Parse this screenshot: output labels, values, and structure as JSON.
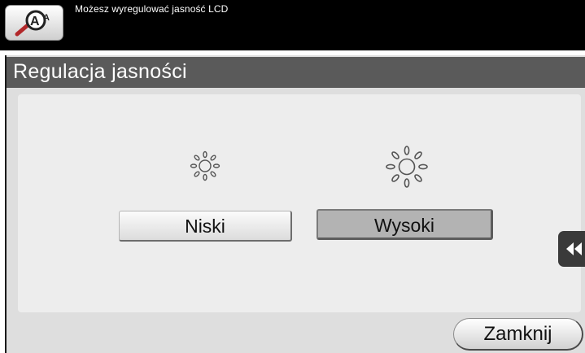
{
  "header": {
    "message": "Możesz wyregulować jasność LCD",
    "accessibility_icon": "accessibility-zoom-icon"
  },
  "title": "Regulacja jasności",
  "brightness": {
    "low": {
      "icon": "sun-small-icon",
      "label": "Niski"
    },
    "high": {
      "icon": "sun-large-icon",
      "label": "Wysoki",
      "selected": true
    }
  },
  "side_tab": {
    "icon": "double-chevron-left-icon"
  },
  "footer": {
    "close_label": "Zamknij"
  },
  "colors": {
    "top_bar": "#000000",
    "title_bar": "#5a5a5a",
    "panel": "#ededed",
    "selected_button": "#b3b3b3"
  }
}
